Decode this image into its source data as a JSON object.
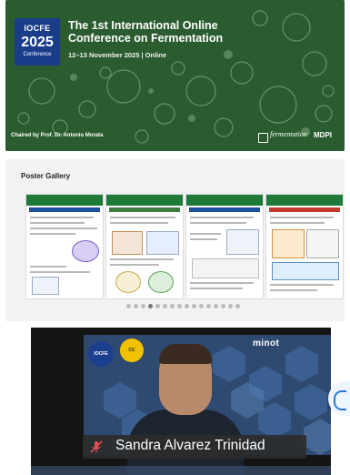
{
  "banner": {
    "badge": {
      "abbr": "IOCFE",
      "year": "2025",
      "label": "Conference"
    },
    "title_line1": "The 1st International Online",
    "title_line2": "Conference on Fermentation",
    "date": "12–13 November 2025 | Online",
    "chair": "Chaired by Prof. Dr. Antonio Morata",
    "journal": "fermentation",
    "publisher": "MDPI"
  },
  "gallery": {
    "title": "Poster Gallery",
    "poster_count": 4,
    "page_dots": 16,
    "active_dot": 3
  },
  "video": {
    "participant_name": "Sandra Alvarez Trinidad",
    "background_brand": "minot",
    "sticker_1": "IOCFE",
    "sticker_2": "CC"
  },
  "colors": {
    "banner_bg": "#2c5a2c",
    "badge_bg": "#1a3d8a",
    "poster_header": "#1f7a3a",
    "name_tag_bg": "#2d2d2d",
    "side_button_accent": "#2a7bd6"
  }
}
